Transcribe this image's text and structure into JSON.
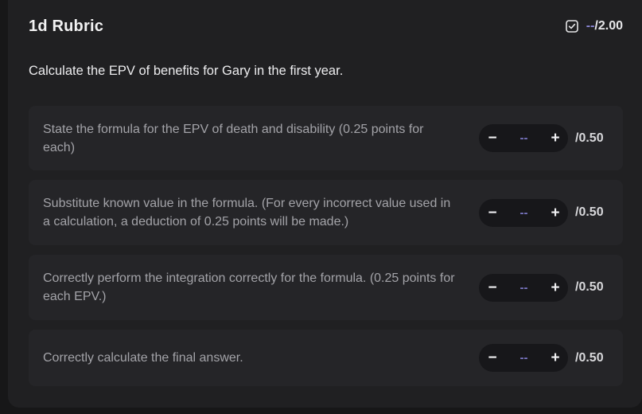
{
  "rubric": {
    "title": "1d Rubric",
    "score_value": "--",
    "score_max": "/2.00",
    "question": "Calculate the EPV of benefits for Gary in the first year."
  },
  "criteria": [
    {
      "text": "State the formula for the EPV of death and disability (0.25 points for each)",
      "value": "--",
      "max": "/0.50",
      "minus": "−",
      "plus": "+"
    },
    {
      "text": "Substitute known value in the formula. (For every incorrect value used in a calculation, a deduction of 0.25 points will be made.)",
      "value": "--",
      "max": "/0.50",
      "minus": "−",
      "plus": "+"
    },
    {
      "text": "Correctly perform the integration correctly for the formula. (0.25 points for each EPV.)",
      "value": "--",
      "max": "/0.50",
      "minus": "−",
      "plus": "+"
    },
    {
      "text": "Correctly calculate the final answer.",
      "value": "--",
      "max": "/0.50",
      "minus": "−",
      "plus": "+"
    }
  ],
  "icons": {
    "score": "checkbox-icon"
  },
  "colors": {
    "accent": "#8a86d6",
    "panel": "#202022",
    "row": "#252528",
    "stepper": "#17171a"
  }
}
